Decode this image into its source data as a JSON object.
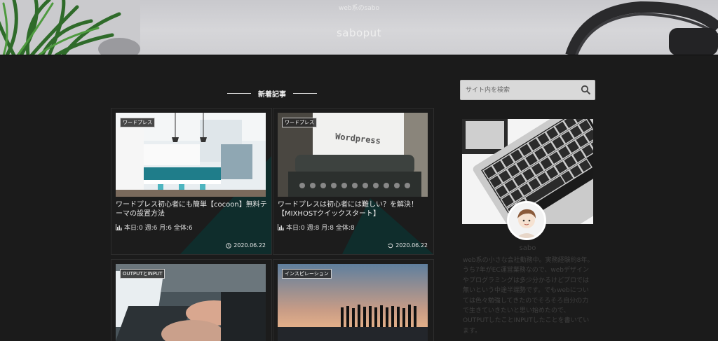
{
  "header": {
    "tagline": "web系のsabo",
    "site_name": "saboput"
  },
  "main": {
    "section_title": "新着記事",
    "cards": [
      {
        "category": "ワードプレス",
        "title": "ワードプレス初心者にも簡単【cocoon】無料テーマの設置方法",
        "stats": "本日:0 週:6 月:6 全体:6",
        "date": "2020.06.22",
        "date_icon": "clock-icon"
      },
      {
        "category": "ワードプレス",
        "title": "ワードプレスは初心者には難しい？を解決！【MIXHOSTクイックスタート】",
        "stats": "本日:0 週:8 月:8 全体:8",
        "date": "2020.06.22",
        "date_icon": "update-icon",
        "thumb_text": "Wordpress"
      },
      {
        "category": "OUTPUTとINPUT"
      },
      {
        "category": "インスピレーション"
      }
    ]
  },
  "sidebar": {
    "search_placeholder": "サイト内を検索",
    "profile_name": "sabo",
    "profile_desc": "web系の小さな会社勤務中。実務経験約8年。うち7年がEC運営業務なので、webデザインやプログラミングは多少分かるけどプロでは無いという中途半端勢です。でもwebについては色々勉強してきたのでそろそろ自分の力で生きていきたいと思い始めたので、OUTPUTしたことINPUTしたことを書いています。"
  },
  "colors": {
    "background": "#1b1b1b",
    "card_accent": "#0f2d2c",
    "header_bg": "#d3d3d6"
  }
}
